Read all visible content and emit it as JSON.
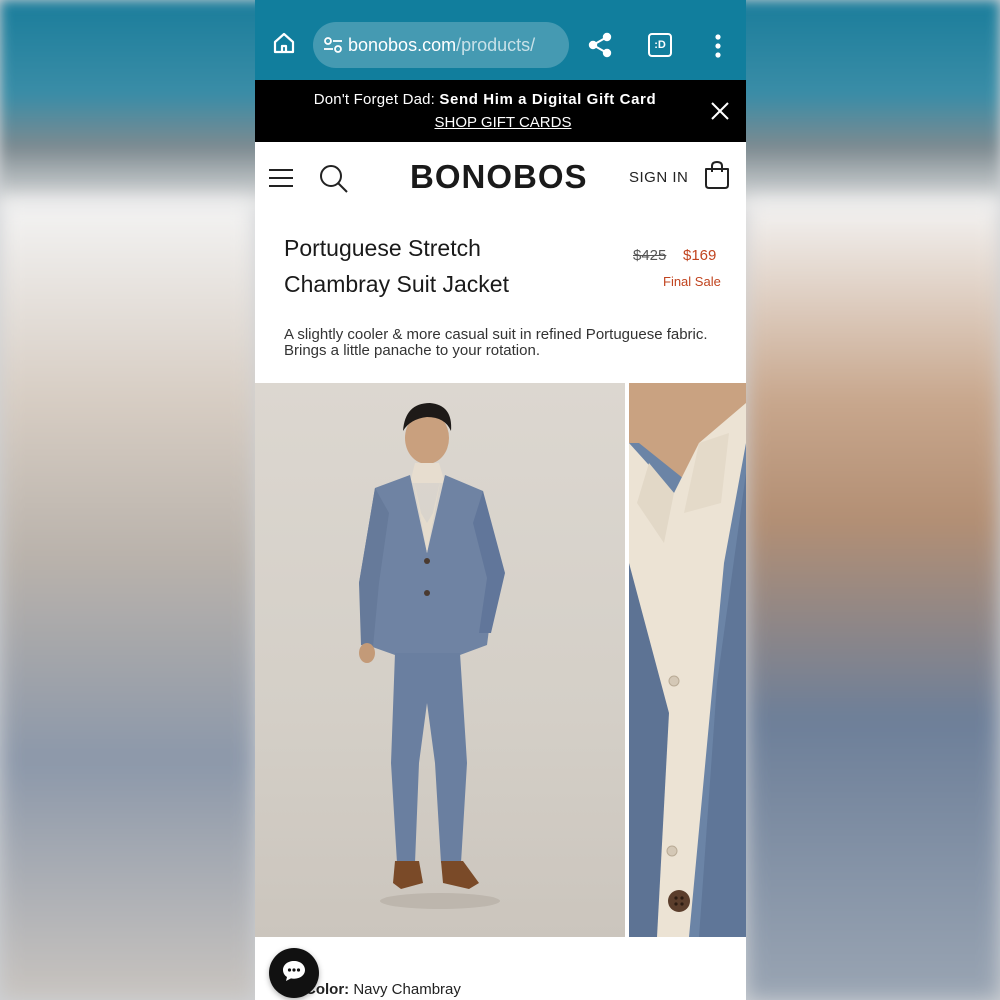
{
  "browser": {
    "url_domain": "bonobos.com",
    "url_path": "/products/",
    "tab_badge": ":D",
    "theme_color": "#117e9d"
  },
  "promo": {
    "prefix": "Don't Forget Dad: ",
    "highlight": "Send Him a Digital Gift Card",
    "link": "SHOP GIFT CARDS"
  },
  "header": {
    "logo": "BONOBOS",
    "sign_in": "SIGN IN"
  },
  "product": {
    "title_line1": "Portuguese Stretch",
    "title_line2": "Chambray Suit Jacket",
    "price_original": "$425",
    "price_sale": "$169",
    "sale_label": "Final Sale",
    "description": "A slightly cooler & more casual suit in refined Portuguese fabric. Brings a little panache to your rotation.",
    "color_label": "Color:",
    "color_value": "Navy Chambray",
    "sale_color": "#c1441f"
  }
}
